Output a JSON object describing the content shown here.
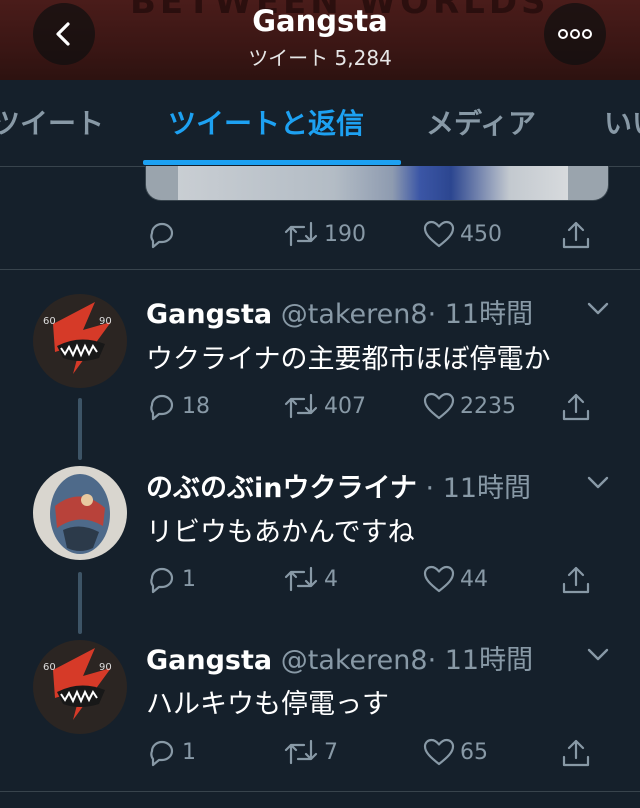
{
  "header": {
    "title": "Gangsta",
    "subtitle": "ツイート 5,284",
    "banner_text": "BETWEEN WORLDS"
  },
  "tabs": [
    {
      "label": "ツイート",
      "active": false
    },
    {
      "label": "ツイートと返信",
      "active": true
    },
    {
      "label": "メディア",
      "active": false
    },
    {
      "label": "いいね",
      "active": false
    }
  ],
  "top_actions": {
    "replies": "",
    "retweets": "190",
    "likes": "450"
  },
  "tweets": [
    {
      "name": "Gangsta",
      "handle": "@takeren8",
      "time": "· 11時間",
      "text": "ウクライナの主要都市ほぼ停電か",
      "replies": "18",
      "retweets": "407",
      "likes": "2235"
    },
    {
      "name": "のぶのぶinウクライナ",
      "handle": "",
      "time": "· 11時間",
      "text": "リビウもあかんですね",
      "replies": "1",
      "retweets": "4",
      "likes": "44"
    },
    {
      "name": "Gangsta",
      "handle": "@takeren8",
      "time": "· 11時間",
      "text": "ハルキウも停電っす",
      "replies": "1",
      "retweets": "7",
      "likes": "65"
    }
  ],
  "colors": {
    "background": "#15202b",
    "accent": "#1da1f2",
    "muted": "#8899a6",
    "border": "#38444d"
  },
  "icons": [
    "back-arrow-icon",
    "more-icon",
    "reply-icon",
    "retweet-icon",
    "like-icon",
    "share-icon",
    "chevron-down-icon"
  ]
}
